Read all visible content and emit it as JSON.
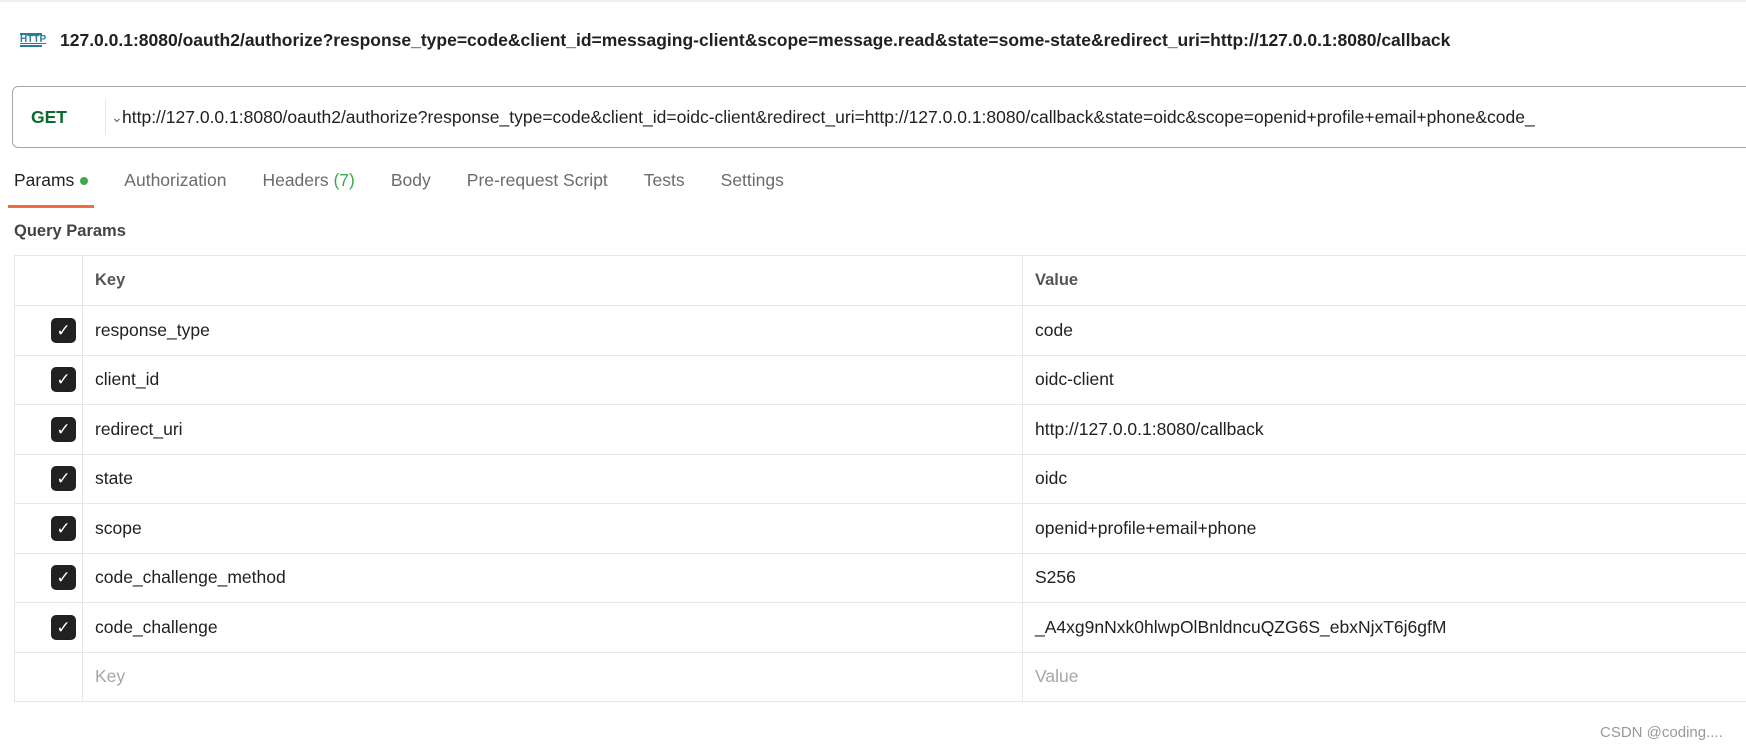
{
  "request": {
    "title": "127.0.0.1:8080/oauth2/authorize?response_type=code&client_id=messaging-client&scope=message.read&state=some-state&redirect_uri=http://127.0.0.1:8080/callback",
    "protocol_icon": "HTTP"
  },
  "urlbar": {
    "method": "GET",
    "url": "http://127.0.0.1:8080/oauth2/authorize?response_type=code&client_id=oidc-client&redirect_uri=http://127.0.0.1:8080/callback&state=oidc&scope=openid+profile+email+phone&code_"
  },
  "tabs": [
    {
      "label": "Params"
    },
    {
      "label": "Authorization"
    },
    {
      "label": "Headers",
      "count": "(7)"
    },
    {
      "label": "Body"
    },
    {
      "label": "Pre-request Script"
    },
    {
      "label": "Tests"
    },
    {
      "label": "Settings"
    }
  ],
  "query_params": {
    "title": "Query Params",
    "headers": {
      "key": "Key",
      "value": "Value"
    },
    "rows": [
      {
        "key": "response_type",
        "value": "code",
        "checked": true
      },
      {
        "key": "client_id",
        "value": "oidc-client",
        "checked": true
      },
      {
        "key": "redirect_uri",
        "value": "http://127.0.0.1:8080/callback",
        "checked": true
      },
      {
        "key": "state",
        "value": "oidc",
        "checked": true
      },
      {
        "key": "scope",
        "value": "openid+profile+email+phone",
        "checked": true
      },
      {
        "key": "code_challenge_method",
        "value": "S256",
        "checked": true
      },
      {
        "key": "code_challenge",
        "value": "_A4xg9nNxk0hlwpOlBnldncuQZG6S_ebxNjxT6j6gfM",
        "checked": true
      }
    ],
    "placeholder": {
      "key": "Key",
      "value": "Value"
    }
  },
  "watermark": "CSDN @coding....",
  "colors": {
    "accent": "#f26b3a",
    "method": "#0b6b2b",
    "status_dot": "#3cab4c"
  }
}
